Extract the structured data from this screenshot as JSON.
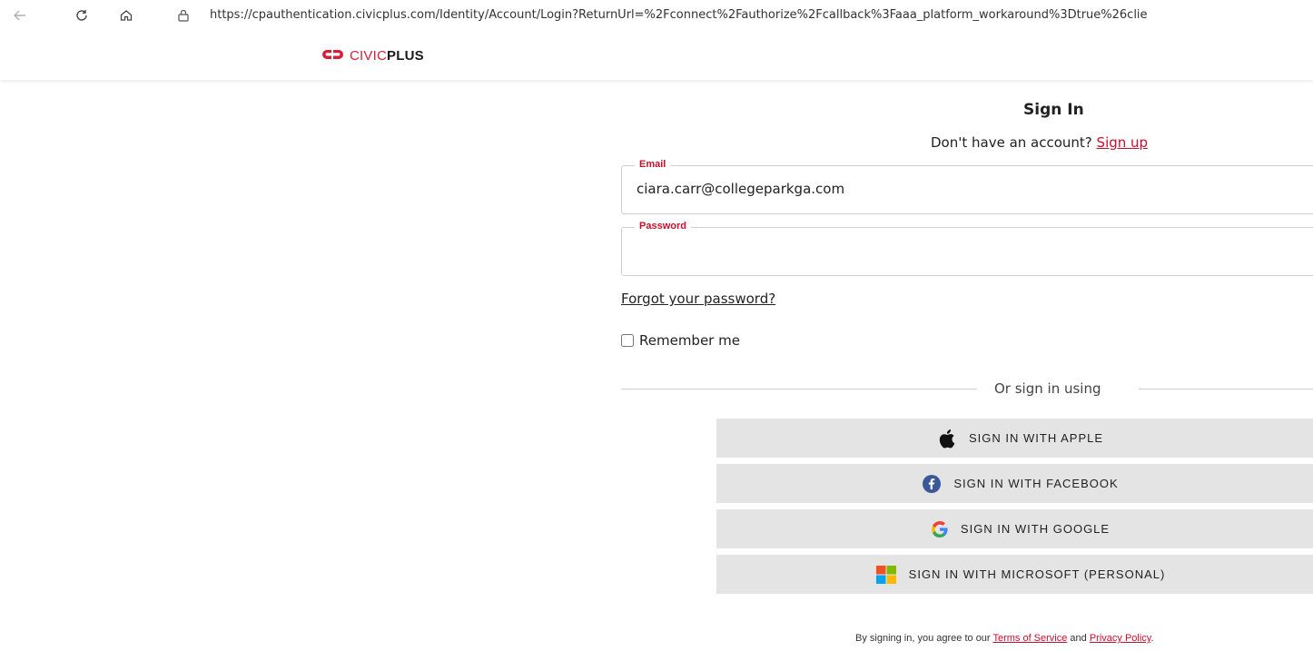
{
  "browser": {
    "url": "https://cpauthentication.civicplus.com/Identity/Account/Login?ReturnUrl=%2Fconnect%2Fauthorize%2Fcallback%3Faaa_platform_workaround%3Dtrue%26clie"
  },
  "header": {
    "logo_civic": "CIVIC",
    "logo_plus": "PLUS"
  },
  "signin": {
    "title": "Sign In",
    "no_account": "Don't have an account? ",
    "signup_link": "Sign up",
    "email_label": "Email",
    "email_value": "ciara.carr@collegeparkga.com",
    "password_label": "Password",
    "password_value": "",
    "forgot_link": "Forgot your password?",
    "remember_label": "Remember me",
    "or_text": "Or sign in using"
  },
  "social": {
    "apple": "SIGN IN WITH APPLE",
    "facebook": "SIGN IN WITH FACEBOOK",
    "google": "SIGN IN WITH GOOGLE",
    "microsoft": "SIGN IN WITH MICROSOFT (PERSONAL)"
  },
  "footer": {
    "prefix": "By signing in, you agree to our ",
    "terms": "Terms of Service",
    "and": " and ",
    "privacy": "Privacy Policy",
    "suffix": "."
  },
  "colors": {
    "brand_red": "#c8102e",
    "button_bg": "#e4e4e4",
    "facebook_blue": "#3b5998"
  }
}
